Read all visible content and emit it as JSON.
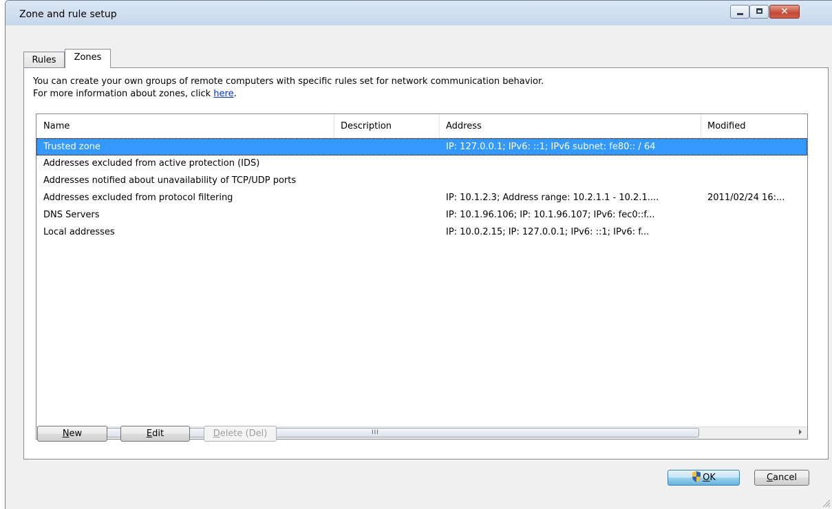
{
  "window": {
    "title": "Zone and rule setup",
    "close_glyph": "✕"
  },
  "tabs": [
    {
      "label": "Rules"
    },
    {
      "label": "Zones"
    }
  ],
  "info": {
    "line1": "You can create your own groups of remote computers with specific rules set for network communication behavior.",
    "line2_prefix": "For more information about zones, click ",
    "line2_link": "here",
    "line2_suffix": "."
  },
  "table": {
    "columns": [
      {
        "label": "Name"
      },
      {
        "label": "Description"
      },
      {
        "label": "Address"
      },
      {
        "label": "Modified"
      }
    ],
    "rows": [
      {
        "name": "Trusted zone",
        "description": "",
        "address": "IP: 127.0.0.1; IPv6: ::1; IPv6 subnet: fe80:: / 64",
        "modified": ""
      },
      {
        "name": "Addresses excluded from active protection (IDS)",
        "description": "",
        "address": "",
        "modified": ""
      },
      {
        "name": "Addresses notified about unavailability of TCP/UDP ports",
        "description": "",
        "address": "",
        "modified": ""
      },
      {
        "name": "Addresses excluded from protocol filtering",
        "description": "",
        "address": "IP: 10.1.2.3; Address range: 10.2.1.1 - 10.2.1....",
        "modified": "2011/02/24 16:..."
      },
      {
        "name": "DNS Servers",
        "description": "",
        "address": "IP: 10.1.96.106; IP: 10.1.96.107; IPv6: fec0::f...",
        "modified": ""
      },
      {
        "name": "Local addresses",
        "description": "",
        "address": "IP: 10.0.2.15; IP: 127.0.0.1; IPv6: ::1; IPv6: f...",
        "modified": ""
      }
    ],
    "selected_row": "Trusted zone",
    "scroll_grip": "III"
  },
  "buttons": {
    "new_first": "N",
    "new_rest": "ew",
    "edit_first": "E",
    "edit_rest": "dit",
    "delete_first": "D",
    "delete_rest": "elete (Del)",
    "ok_first": "O",
    "ok_rest": "K",
    "cancel_first": "C",
    "cancel_rest": "ancel"
  },
  "icons": {
    "ok_shield": "uac-shield-icon"
  }
}
